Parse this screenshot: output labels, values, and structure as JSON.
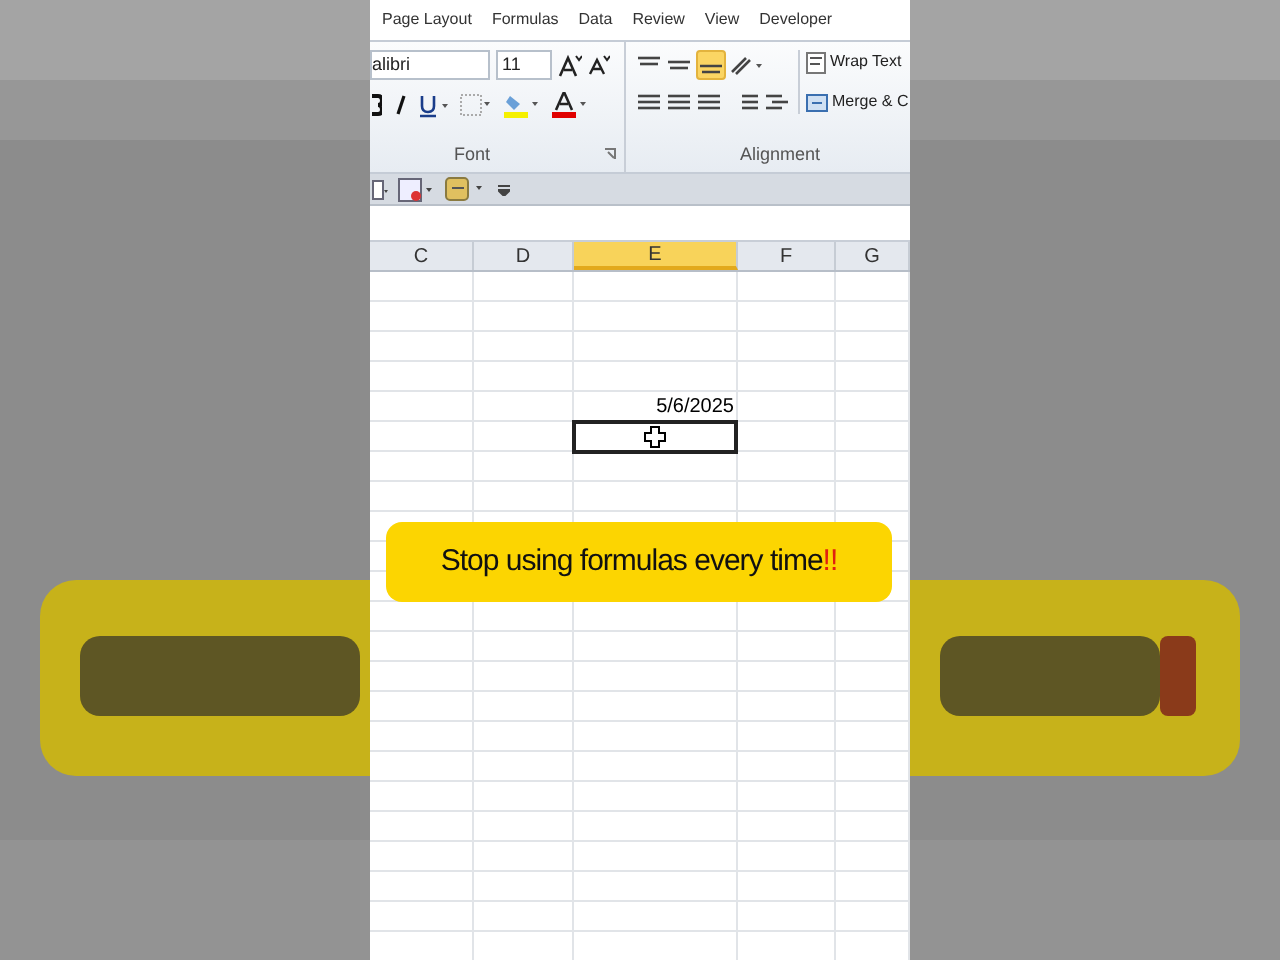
{
  "ribbon_tabs": [
    {
      "label": "Page Layout"
    },
    {
      "label": "Formulas"
    },
    {
      "label": "Data"
    },
    {
      "label": "Review"
    },
    {
      "label": "View"
    },
    {
      "label": "Developer"
    }
  ],
  "font_group": {
    "font_name": "alibri",
    "font_size": "11",
    "label": "Font"
  },
  "alignment_group": {
    "wrap_text": "Wrap Text",
    "merge": "Merge & C",
    "bottom_align_selected": true,
    "label": "Alignment"
  },
  "columns": [
    {
      "label": "C",
      "selected": false
    },
    {
      "label": "D",
      "selected": false
    },
    {
      "label": "E",
      "selected": true
    },
    {
      "label": "F",
      "selected": false
    },
    {
      "label": "G",
      "selected": false
    }
  ],
  "date_cell": {
    "value": "5/6/2025"
  },
  "caption": {
    "text": "Stop using formulas every time",
    "emphasis": "!!"
  }
}
